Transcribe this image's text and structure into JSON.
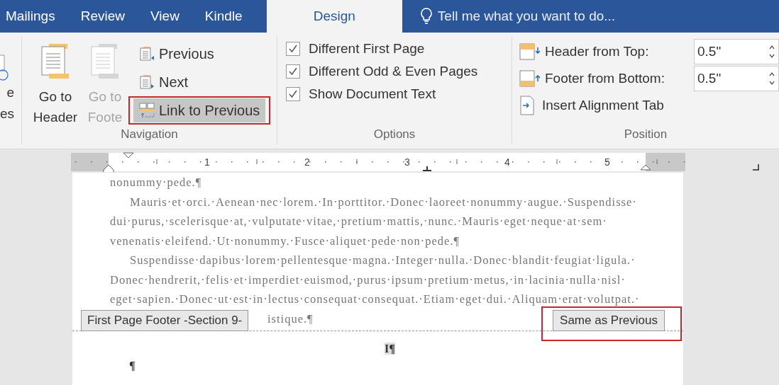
{
  "tabs": [
    {
      "label": "Mailings",
      "selected": false
    },
    {
      "label": "Review",
      "selected": false
    },
    {
      "label": "View",
      "selected": false
    },
    {
      "label": "Kindle",
      "selected": false
    },
    {
      "label": "Design",
      "selected": true
    }
  ],
  "tell_me": {
    "placeholder": "Tell me what you want to do..."
  },
  "ribbon": {
    "cut_group": {
      "lines": [
        "e",
        "es"
      ]
    },
    "navigation": {
      "label": "Navigation",
      "large_buttons": [
        {
          "lines": [
            "Go to",
            "Header"
          ],
          "disabled": false
        },
        {
          "lines": [
            "Go to",
            "Foote"
          ],
          "disabled": true
        }
      ],
      "small_buttons": [
        {
          "label": "Previous",
          "kind": "previous",
          "selected": false,
          "highlighted": false
        },
        {
          "label": "Next",
          "kind": "next",
          "selected": false,
          "highlighted": false
        },
        {
          "label": "Link to Previous",
          "kind": "link",
          "selected": true,
          "highlighted": true
        }
      ]
    },
    "options": {
      "label": "Options",
      "checkboxes": [
        {
          "label": "Different First Page",
          "checked": true
        },
        {
          "label": "Different Odd & Even Pages",
          "checked": true
        },
        {
          "label": "Show Document Text",
          "checked": true
        }
      ]
    },
    "position": {
      "label": "Position",
      "rows": [
        {
          "kind": "spinner",
          "label": "Header from Top:",
          "value": "0.5\""
        },
        {
          "kind": "spinner",
          "label": "Footer from Bottom:",
          "value": "0.5\""
        },
        {
          "kind": "button",
          "label": "Insert Alignment Tab"
        }
      ]
    }
  },
  "ruler": {
    "numbers": [
      "1",
      "2",
      "3",
      "4",
      "5"
    ]
  },
  "document": {
    "lines": [
      {
        "text": "nonummy·pede.¶",
        "kind": "end"
      },
      {
        "text": "Mauris·et·orci.·Aenean·nec·lorem.·In·porttitor.·Donec·laoreet·nonummy·augue.·Suspendisse·",
        "kind": "first"
      },
      {
        "text": "dui·purus,·scelerisque·at,·vulputate·vitae,·pretium·mattis,·nunc.·Mauris·eget·neque·at·sem·",
        "kind": "full"
      },
      {
        "text": "venenatis·eleifend.·Ut·nonummy.·Fusce·aliquet·pede·non·pede.¶",
        "kind": "end"
      },
      {
        "text": "Suspendisse·dapibus·lorem·pellentesque·magna.·Integer·nulla.·Donec·blandit·feugiat·ligula.·",
        "kind": "first"
      },
      {
        "text": "Donec·hendrerit,·felis·et·imperdiet·euismod,·purus·ipsum·pretium·metus,·in·lacinia·nulla·nisl·",
        "kind": "full"
      },
      {
        "text": "eget·sapien.·Donec·ut·est·in·lectus·consequat·consequat.·Etiam·eget·dui.·Aliquam·erat·volutpat.·",
        "kind": "full"
      }
    ],
    "covered_line": "istique.¶",
    "footer_tag": "First Page Footer -Section 9-",
    "same_as_previous": {
      "label": "Same as Previous",
      "highlighted": true
    },
    "footer_lines": [
      "I¶",
      "¶"
    ]
  }
}
